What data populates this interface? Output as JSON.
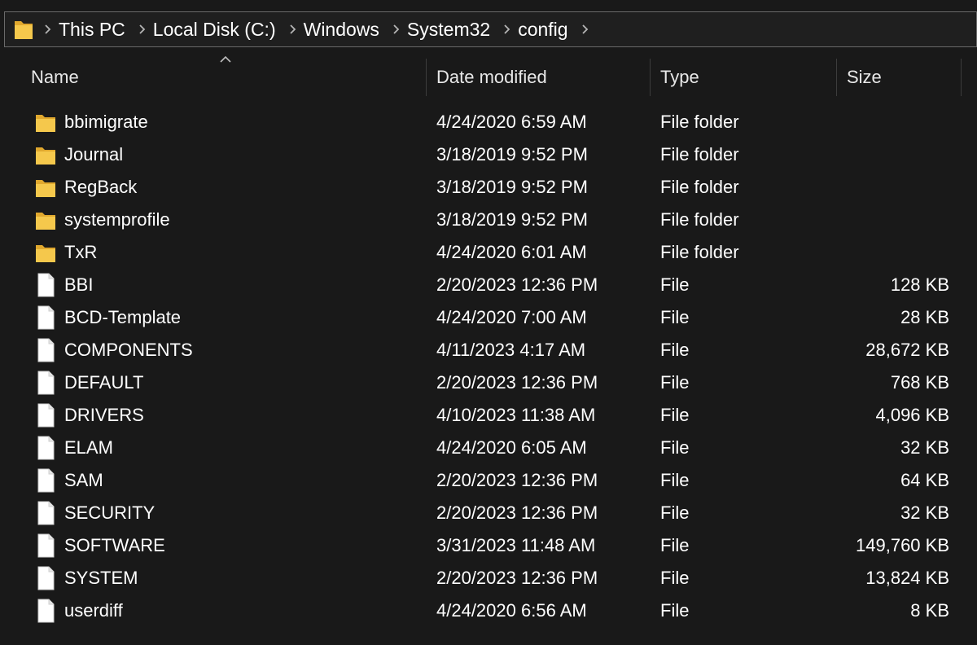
{
  "breadcrumb": [
    "This PC",
    "Local Disk (C:)",
    "Windows",
    "System32",
    "config"
  ],
  "icons": {
    "address_folder": "folder-icon",
    "breadcrumb_separator": "chevron-right-icon",
    "sort_indicator": "sort-ascending-icon",
    "folder": "folder-icon",
    "file": "file-icon"
  },
  "colors": {
    "background": "#191919",
    "folder": "#f5c84c",
    "file": "#ffffff"
  },
  "columns": {
    "name": "Name",
    "date": "Date modified",
    "type": "Type",
    "size": "Size"
  },
  "files": [
    {
      "name": "bbimigrate",
      "date": "4/24/2020 6:59 AM",
      "type": "File folder",
      "size": "",
      "kind": "folder"
    },
    {
      "name": "Journal",
      "date": "3/18/2019 9:52 PM",
      "type": "File folder",
      "size": "",
      "kind": "folder"
    },
    {
      "name": "RegBack",
      "date": "3/18/2019 9:52 PM",
      "type": "File folder",
      "size": "",
      "kind": "folder"
    },
    {
      "name": "systemprofile",
      "date": "3/18/2019 9:52 PM",
      "type": "File folder",
      "size": "",
      "kind": "folder"
    },
    {
      "name": "TxR",
      "date": "4/24/2020 6:01 AM",
      "type": "File folder",
      "size": "",
      "kind": "folder"
    },
    {
      "name": "BBI",
      "date": "2/20/2023 12:36 PM",
      "type": "File",
      "size": "128 KB",
      "kind": "file"
    },
    {
      "name": "BCD-Template",
      "date": "4/24/2020 7:00 AM",
      "type": "File",
      "size": "28 KB",
      "kind": "file"
    },
    {
      "name": "COMPONENTS",
      "date": "4/11/2023 4:17 AM",
      "type": "File",
      "size": "28,672 KB",
      "kind": "file"
    },
    {
      "name": "DEFAULT",
      "date": "2/20/2023 12:36 PM",
      "type": "File",
      "size": "768 KB",
      "kind": "file"
    },
    {
      "name": "DRIVERS",
      "date": "4/10/2023 11:38 AM",
      "type": "File",
      "size": "4,096 KB",
      "kind": "file"
    },
    {
      "name": "ELAM",
      "date": "4/24/2020 6:05 AM",
      "type": "File",
      "size": "32 KB",
      "kind": "file"
    },
    {
      "name": "SAM",
      "date": "2/20/2023 12:36 PM",
      "type": "File",
      "size": "64 KB",
      "kind": "file"
    },
    {
      "name": "SECURITY",
      "date": "2/20/2023 12:36 PM",
      "type": "File",
      "size": "32 KB",
      "kind": "file"
    },
    {
      "name": "SOFTWARE",
      "date": "3/31/2023 11:48 AM",
      "type": "File",
      "size": "149,760 KB",
      "kind": "file"
    },
    {
      "name": "SYSTEM",
      "date": "2/20/2023 12:36 PM",
      "type": "File",
      "size": "13,824 KB",
      "kind": "file"
    },
    {
      "name": "userdiff",
      "date": "4/24/2020 6:56 AM",
      "type": "File",
      "size": "8 KB",
      "kind": "file"
    }
  ]
}
